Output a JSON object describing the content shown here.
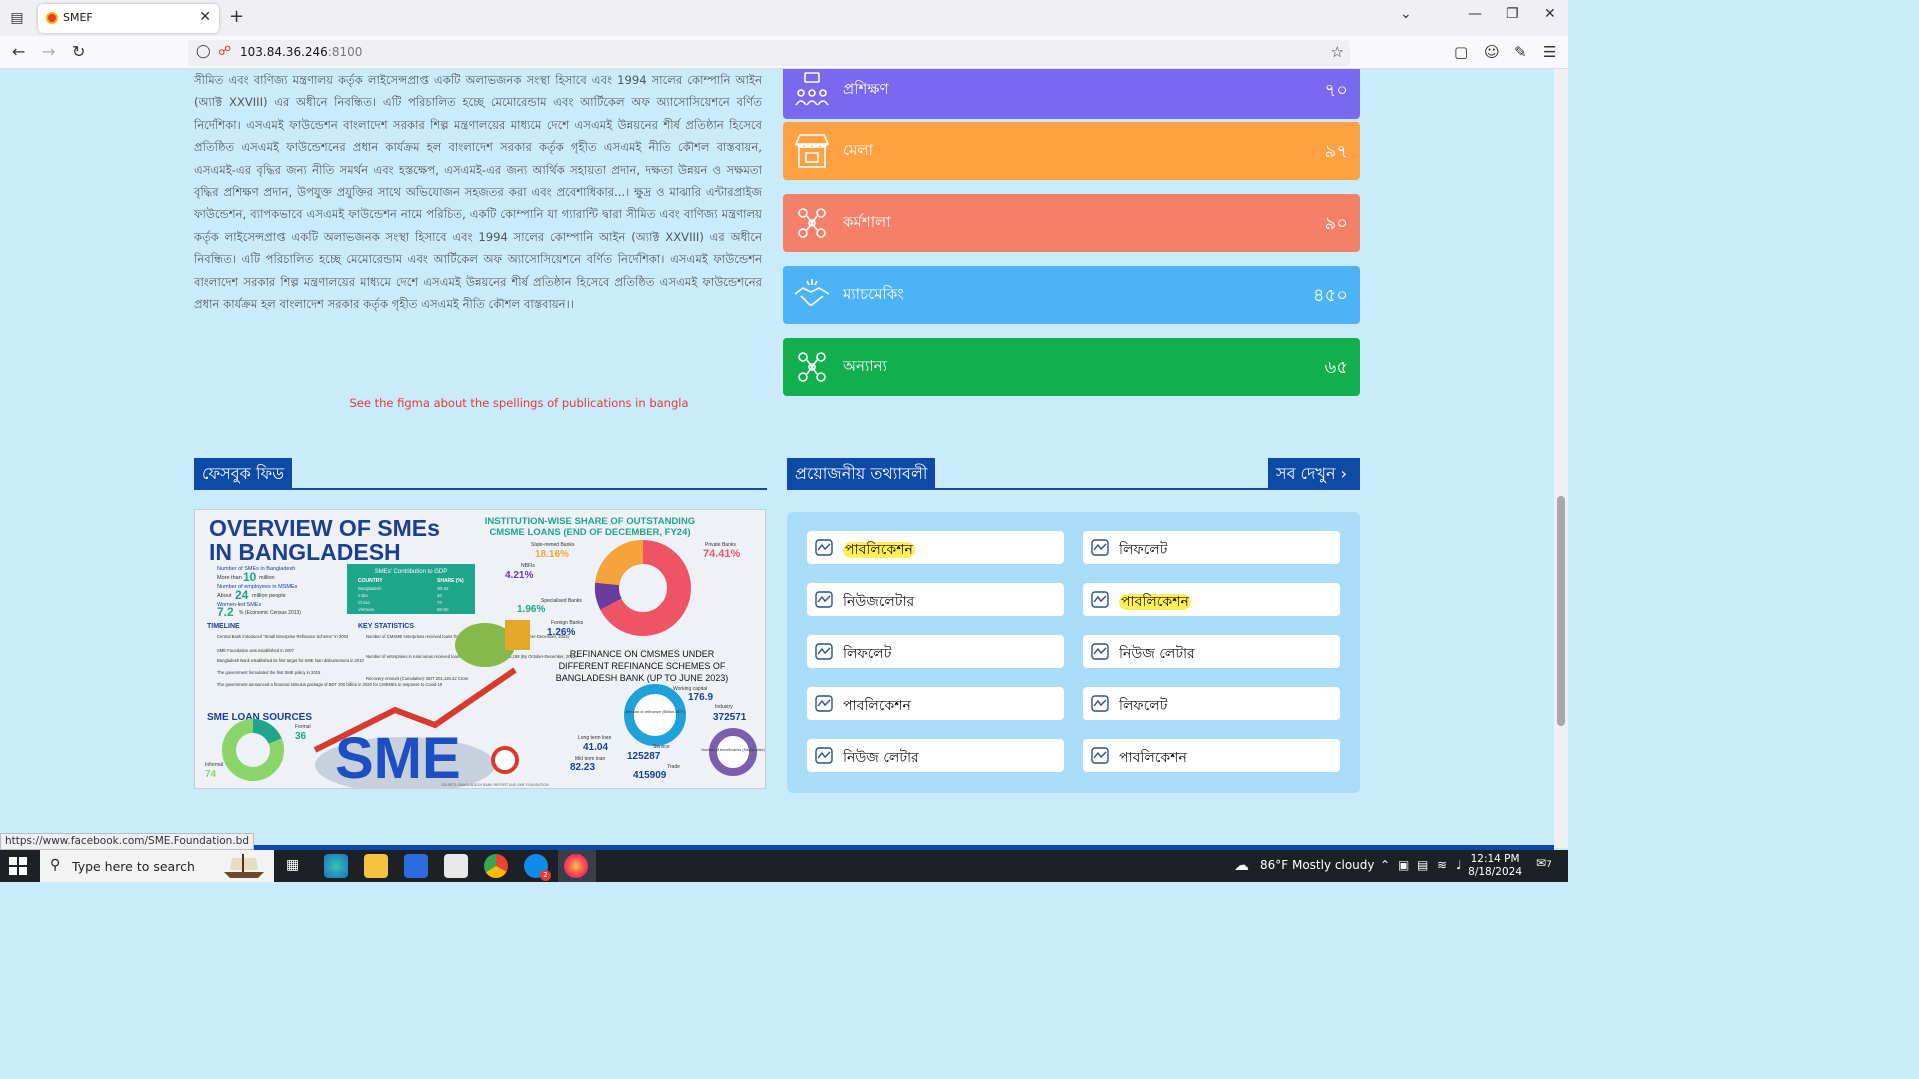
{
  "browser": {
    "tab_title": "SMEF",
    "new_tab": "+",
    "url_host": "103.84.36.246",
    "url_port": ":8100",
    "status_url": "https://www.facebook.com/SME.Foundation.bd"
  },
  "about": {
    "text": "সীমিত এবং বাণিজ্য মন্ত্রণালয় কর্তৃক লাইসেন্সপ্রাপ্ত একটি অলাভজনক সংস্থা হিসাবে এবং 1994 সালের কোম্পানি আইন (অ্যাক্ট XXVIII) এর অধীনে নিবন্ধিত। এটি পরিচালিত হচ্ছে মেমোরেন্ডাম এবং আর্টিকেল অফ অ্যাসোসিয়েশনে বর্ণিত নির্দেশিকা। এসএমই ফাউন্ডেশন বাংলাদেশ সরকার শিল্প মন্ত্রণালয়ের মাধ্যমে দেশে এসএমই উন্নয়নের শীর্ষ প্রতিষ্ঠান হিসেবে প্রতিষ্ঠিত এসএমই ফাউন্ডেশনের প্রধান কার্যক্রম হল বাংলাদেশ সরকার কর্তৃক গৃহীত এসএমই নীতি কৌশল বাস্তবায়ন, এসএমই-এর বৃদ্ধির জন্য নীতি সমর্থন এবং হস্তক্ষেপ, এসএমই-এর জন্য আর্থিক সহায়তা প্রদান, দক্ষতা উন্নয়ন ও সক্ষমতা বৃদ্ধির প্রশিক্ষণ প্রদান, উপযুক্ত প্রযুক্তির সাথে অভিযোজন সহজতর করা এবং প্রবেশাধিকার...। ক্ষুদ্র ও মাঝারি এন্টারপ্রাইজ ফাউন্ডেশন, ব্যাপকভাবে এসএমই ফাউন্ডেশন নামে পরিচিত, একটি কোম্পানি যা গ্যারান্টি দ্বারা সীমিত এবং বাণিজ্য মন্ত্রণালয় কর্তৃক লাইসেন্সপ্রাপ্ত একটি অলাভজনক সংস্থা হিসাবে এবং 1994 সালের কোম্পানি আইন (অ্যাক্ট XXVIII) এর অধীনে নিবন্ধিত। এটি পরিচালিত হচ্ছে মেমোরেন্ডাম এবং আর্টিকেল অফ অ্যাসোসিয়েশনে বর্ণিত নির্দেশিকা। এসএমই ফাউন্ডেশন বাংলাদেশ সরকার শিল্প মন্ত্রণালয়ের মাধ্যমে দেশে এসএমই উন্নয়নের শীর্ষ প্রতিষ্ঠান হিসেবে প্রতিষ্ঠিত এসএমই ফাউন্ডেশনের প্রধান কার্যক্রম হল বাংলাদেশ সরকার কর্তৃক গৃহীত এসএমই নীতি কৌশল বাস্তবায়ন।।",
    "note": "See the figma about the spellings of publications in bangla"
  },
  "stats": [
    {
      "label": "প্রশিক্ষণ",
      "value": "৭০",
      "color": "#7b68ee",
      "icon": "training-icon"
    },
    {
      "label": "মেলা",
      "value": "৯৭",
      "color": "#ffa142",
      "icon": "fair-stall-icon"
    },
    {
      "label": "কর্মশালা",
      "value": "৯০",
      "color": "#f4806a",
      "icon": "workshop-icon"
    },
    {
      "label": "ম্যাচমেকিং",
      "value": "৪৫০",
      "color": "#4db3f7",
      "icon": "handshake-icon"
    },
    {
      "label": "অন্যান্য",
      "value": "৬৫",
      "color": "#12b04d",
      "icon": "others-icon"
    }
  ],
  "facebook": {
    "heading": "ফেসবুক ফিড",
    "post": {
      "title_line1": "OVERVIEW OF SMEs",
      "title_line2": "IN BANGLADESH",
      "subtitle": "INSTITUTION-WISE SHARE OF OUTSTANDING",
      "subtitle2": "CMSME LOANS (END OF DECEMBER, FY24)",
      "stat1": "Number of SMEs in Bangladesh",
      "stat1_val": "10",
      "stat1_unit": "More than",
      "stat1_tail": "million",
      "stat2": "Number of employees in MSMEs",
      "stat2_val": "24",
      "stat2_unit": "About",
      "stat2_tail": "million people",
      "stat3": "Women-led SMEs",
      "stat3_val": "7.2",
      "stat3_tail": "% (Economic Census 2013)",
      "gdp_title": "SMEs' Contribution to GDP",
      "gdp_col1": "COUNTRY",
      "gdp_col2": "SHARE (%)",
      "gdp_rows": [
        [
          "Bangladesh",
          "30-32"
        ],
        [
          "India",
          "40"
        ],
        [
          "China",
          "70"
        ],
        [
          "Vietnam",
          "50-60"
        ]
      ],
      "timeline_title": "TIMELINE",
      "timeline": [
        "Central Bank introduced \"Small Enterprise Refinance Scheme\" in 2004",
        "SME Foundation was established in 2007",
        "Bangladesh Bank established its first target for SME loan disbursement in 2010",
        "The government formulated the first SME policy in 2015",
        "The government announced a financial stimulus package of BDT 200 billion in 2020 for CMSMEs in response to Covid-19"
      ],
      "key_title": "KEY STATISTICS",
      "key": [
        "Number of CMSME enterprises received loans from Banks and NBFIs: 369016 (By October-December, 2023)",
        "Number of enterprises in rural areas received loans from Banks and NBFIs: 95,188 (By October-December, 2023)",
        "Recovery Amount (Cumulative): BDT 201,126.42 Crore"
      ],
      "loan_title": "SME LOAN SOURCES",
      "loan_formal": "Formal",
      "loan_formal_val": "36",
      "loan_informal": "Informal",
      "loan_informal_val": "74",
      "donut_private": "Private Banks",
      "donut_private_val": "74.41%",
      "donut_state": "State-owned Banks",
      "donut_state_val": "18.16%",
      "donut_nbfi": "NBFIs",
      "donut_nbfi_val": "4.21%",
      "donut_special": "Specialised Banks",
      "donut_special_val": "1.96%",
      "donut_foreign": "Foreign Banks",
      "donut_foreign_val": "1.26%",
      "refinance_l1": "REFINANCE ON CMSMES UNDER",
      "refinance_l2": "DIFFERENT REFINANCE SCHEMES OF",
      "refinance_l3": "BANGLADESH BANK (UP TO JUNE 2023)",
      "working_capital": "Working capital",
      "working_capital_val": "176.9",
      "industry": "Industry",
      "industry_val": "372571",
      "amount_refinance": "Amount of refinance (Billion BDT)",
      "long_term": "Long term loan",
      "long_term_val": "41.04",
      "mid_term": "Mid term loan",
      "mid_term_val": "82.23",
      "service": "Service",
      "service_val": "125287",
      "trade": "Trade",
      "trade_val": "415909",
      "beneficiaries": "Number of beneficiaries (Sector-wise)",
      "sme_big": "SME",
      "source": "SOURCE: BANGLADESH BANK REPORT AND SME FOUNDATION"
    }
  },
  "info": {
    "heading": "প্রয়োজনীয় তথ্যাবলী",
    "see_all": "সব দেখুন",
    "items": [
      {
        "label": "পাবলিকেশন",
        "highlight": true
      },
      {
        "label": "লিফলেট",
        "highlight": false
      },
      {
        "label": "নিউজলেটার",
        "highlight": false
      },
      {
        "label": "পাবলিকেশন",
        "highlight": true
      },
      {
        "label": "লিফলেট",
        "highlight": false
      },
      {
        "label": "নিউজ লেটার",
        "highlight": false
      },
      {
        "label": "পাবলিকেশন",
        "highlight": false
      },
      {
        "label": "লিফলেট",
        "highlight": false
      },
      {
        "label": "নিউজ লেটার",
        "highlight": false
      },
      {
        "label": "পাবলিকেশন",
        "highlight": false
      }
    ]
  },
  "taskbar": {
    "search_placeholder": "Type here to search",
    "weather": "86°F  Mostly cloudy",
    "time": "12:14 PM",
    "date": "8/18/2024",
    "notifications": "7",
    "skype_badge": "2"
  },
  "colors": {
    "primary": "#0d4aa8",
    "page_bg": "#c9ebfb",
    "note": "#e53935"
  }
}
